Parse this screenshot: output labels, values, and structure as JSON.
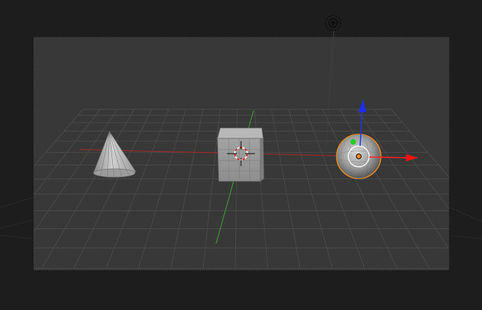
{
  "viewport": {
    "mode": "camera-view",
    "background_color": "#1d1d1d",
    "camera_frame_color": "#383838",
    "grid_color": "#4a4a4a",
    "x_axis_color": "#a32a2a",
    "y_axis_color": "#3f9a35"
  },
  "objects": [
    {
      "name": "cone",
      "type": "mesh",
      "selected": false
    },
    {
      "name": "cube",
      "type": "mesh",
      "selected": false
    },
    {
      "name": "sphere",
      "type": "mesh",
      "selected": true,
      "outline_color": "#e58a20"
    }
  ],
  "gizmo": {
    "type": "translate",
    "x_axis_color": "#ff2020",
    "y_axis_color": "#22c022",
    "z_axis_color": "#2030ff"
  },
  "cursor_3d": {
    "visible": true
  },
  "camera_indicator": {
    "visible": true
  }
}
